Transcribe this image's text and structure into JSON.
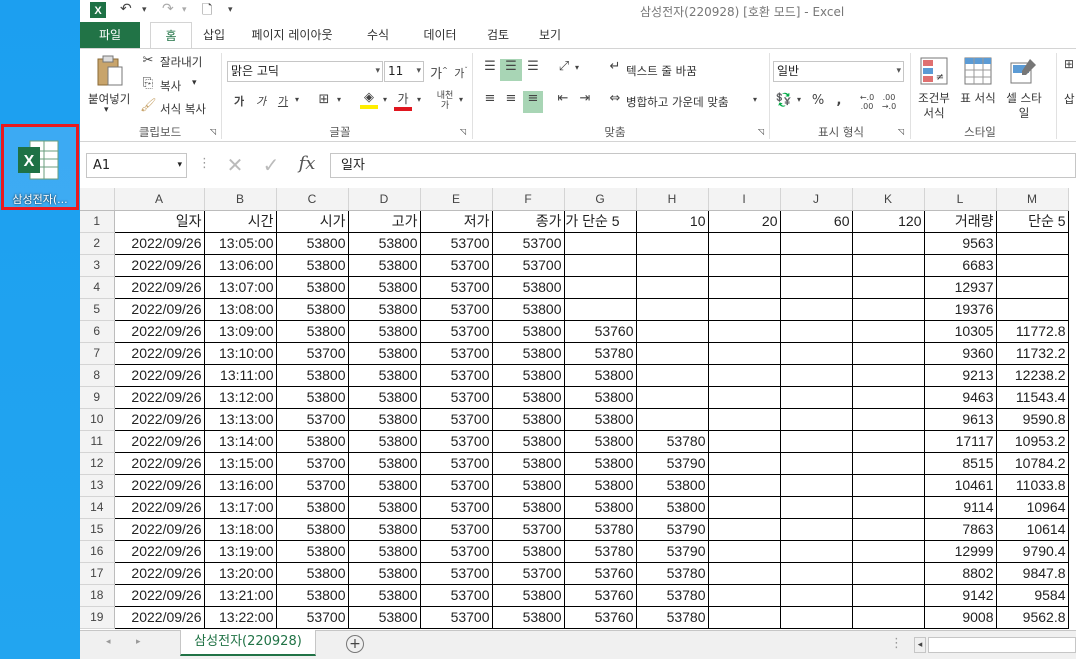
{
  "desktop": {
    "icon_label": "삼성전자(..."
  },
  "titlebar": {
    "title": "삼성전자(220928)  [호환 모드] - Excel"
  },
  "tabs": [
    "파일",
    "홈",
    "삽입",
    "페이지 레이아웃",
    "수식",
    "데이터",
    "검토",
    "보기"
  ],
  "ribbon": {
    "clipboard": {
      "paste": "붙여넣기",
      "cut": "잘라내기",
      "copy": "복사",
      "format_painter": "서식 복사",
      "label": "클립보드"
    },
    "font": {
      "name": "맑은 고딕",
      "size": "11",
      "label": "글꼴"
    },
    "align": {
      "wrap": "텍스트 줄 바꿈",
      "merge": "병합하고 가운데 맞춤",
      "label": "맞춤"
    },
    "number": {
      "format": "일반",
      "label": "표시 형식"
    },
    "style": {
      "cond": "조건부 서식",
      "table": "표 서식",
      "cell": "셀 스타일",
      "label": "스타일",
      "insert": "삽"
    }
  },
  "formula": {
    "name_box": "A1",
    "value": "일자"
  },
  "columns": [
    "A",
    "B",
    "C",
    "D",
    "E",
    "F",
    "G",
    "H",
    "I",
    "J",
    "K",
    "L",
    "M"
  ],
  "header_row": [
    "일자",
    "시간",
    "시가",
    "고가",
    "저가",
    "종가",
    "종가 단순 5",
    "10",
    "20",
    "60",
    "120",
    "거래량",
    "단순 5"
  ],
  "rows": [
    [
      "2022/09/26",
      "13:05:00",
      "53800",
      "53800",
      "53700",
      "53700",
      "",
      "",
      "",
      "",
      "",
      "9563",
      ""
    ],
    [
      "2022/09/26",
      "13:06:00",
      "53800",
      "53800",
      "53700",
      "53700",
      "",
      "",
      "",
      "",
      "",
      "6683",
      ""
    ],
    [
      "2022/09/26",
      "13:07:00",
      "53800",
      "53800",
      "53700",
      "53800",
      "",
      "",
      "",
      "",
      "",
      "12937",
      ""
    ],
    [
      "2022/09/26",
      "13:08:00",
      "53800",
      "53800",
      "53700",
      "53800",
      "",
      "",
      "",
      "",
      "",
      "19376",
      ""
    ],
    [
      "2022/09/26",
      "13:09:00",
      "53800",
      "53800",
      "53700",
      "53800",
      "53760",
      "",
      "",
      "",
      "",
      "10305",
      "11772.8"
    ],
    [
      "2022/09/26",
      "13:10:00",
      "53700",
      "53800",
      "53700",
      "53800",
      "53780",
      "",
      "",
      "",
      "",
      "9360",
      "11732.2"
    ],
    [
      "2022/09/26",
      "13:11:00",
      "53800",
      "53800",
      "53700",
      "53800",
      "53800",
      "",
      "",
      "",
      "",
      "9213",
      "12238.2"
    ],
    [
      "2022/09/26",
      "13:12:00",
      "53800",
      "53800",
      "53700",
      "53800",
      "53800",
      "",
      "",
      "",
      "",
      "9463",
      "11543.4"
    ],
    [
      "2022/09/26",
      "13:13:00",
      "53700",
      "53800",
      "53700",
      "53800",
      "53800",
      "",
      "",
      "",
      "",
      "9613",
      "9590.8"
    ],
    [
      "2022/09/26",
      "13:14:00",
      "53800",
      "53800",
      "53700",
      "53800",
      "53800",
      "53780",
      "",
      "",
      "",
      "17117",
      "10953.2"
    ],
    [
      "2022/09/26",
      "13:15:00",
      "53700",
      "53800",
      "53700",
      "53800",
      "53800",
      "53790",
      "",
      "",
      "",
      "8515",
      "10784.2"
    ],
    [
      "2022/09/26",
      "13:16:00",
      "53700",
      "53800",
      "53700",
      "53800",
      "53800",
      "53800",
      "",
      "",
      "",
      "10461",
      "11033.8"
    ],
    [
      "2022/09/26",
      "13:17:00",
      "53800",
      "53800",
      "53700",
      "53800",
      "53800",
      "53800",
      "",
      "",
      "",
      "9114",
      "10964"
    ],
    [
      "2022/09/26",
      "13:18:00",
      "53800",
      "53800",
      "53700",
      "53700",
      "53780",
      "53790",
      "",
      "",
      "",
      "7863",
      "10614"
    ],
    [
      "2022/09/26",
      "13:19:00",
      "53800",
      "53800",
      "53700",
      "53800",
      "53780",
      "53790",
      "",
      "",
      "",
      "12999",
      "9790.4"
    ],
    [
      "2022/09/26",
      "13:20:00",
      "53800",
      "53800",
      "53700",
      "53700",
      "53760",
      "53780",
      "",
      "",
      "",
      "8802",
      "9847.8"
    ],
    [
      "2022/09/26",
      "13:21:00",
      "53800",
      "53800",
      "53700",
      "53800",
      "53760",
      "53780",
      "",
      "",
      "",
      "9142",
      "9584"
    ],
    [
      "2022/09/26",
      "13:22:00",
      "53700",
      "53800",
      "53700",
      "53800",
      "53760",
      "53780",
      "",
      "",
      "",
      "9008",
      "9562.8"
    ]
  ],
  "sheet_tab": "삼성전자(220928)",
  "colors": {
    "excel_green": "#217346",
    "desktop_blue": "#1da1f2",
    "highlight_red": "#e8191f"
  }
}
